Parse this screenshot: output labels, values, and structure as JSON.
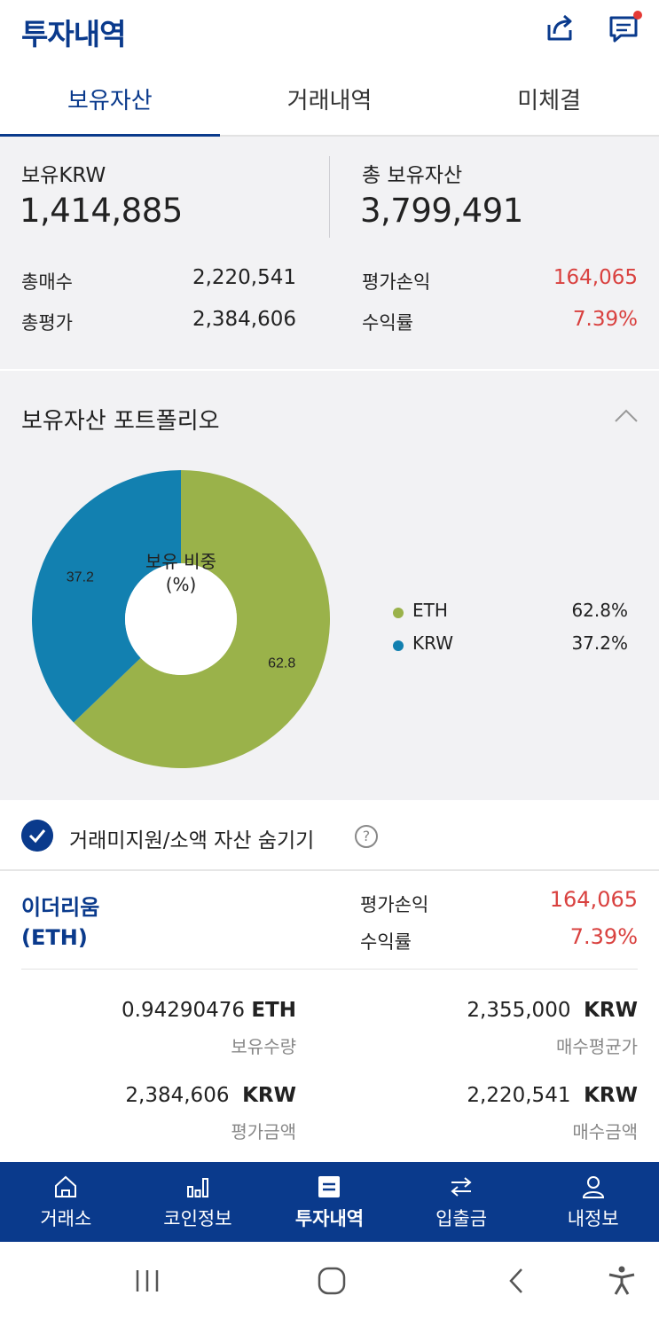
{
  "header": {
    "title": "투자내역"
  },
  "tabs": [
    {
      "label": "보유자산",
      "active": true
    },
    {
      "label": "거래내역",
      "active": false
    },
    {
      "label": "미체결",
      "active": false
    }
  ],
  "summary": {
    "krw_label": "보유KRW",
    "krw_value": "1,414,885",
    "total_label": "총 보유자산",
    "total_value": "3,799,491",
    "buy_label": "총매수",
    "buy_value": "2,220,541",
    "eval_label": "총평가",
    "eval_value": "2,384,606",
    "pl_label": "평가손익",
    "pl_value": "164,065",
    "rate_label": "수익률",
    "rate_value": "7.39%"
  },
  "portfolio": {
    "title": "보유자산 포트폴리오",
    "center_line1": "보유 비중",
    "center_line2": "(%)",
    "legend": [
      {
        "name": "ETH",
        "pct": "62.8%",
        "color": "#9ab24a"
      },
      {
        "name": "KRW",
        "pct": "37.2%",
        "color": "#1280b0"
      }
    ]
  },
  "chart_data": {
    "type": "pie",
    "categories": [
      "ETH",
      "KRW"
    ],
    "values": [
      62.8,
      37.2
    ],
    "colors": [
      "#9ab24a",
      "#1280b0"
    ],
    "data_labels": [
      "62.8",
      "37.2"
    ]
  },
  "hide_small": {
    "label": "거래미지원/소액 자산 숨기기",
    "checked": true,
    "help": "?"
  },
  "coin": {
    "name_line1": "이더리움",
    "name_line2": "(ETH)",
    "pl_label": "평가손익",
    "pl_value": "164,065",
    "rate_label": "수익률",
    "rate_value": "7.39%",
    "qty_value": "0.94290476",
    "qty_unit": "ETH",
    "qty_label": "보유수량",
    "avg_value": "2,355,000",
    "avg_unit": "KRW",
    "avg_label": "매수평균가",
    "eval_value": "2,384,606",
    "eval_unit": "KRW",
    "eval_label": "평가금액",
    "buy_value": "2,220,541",
    "buy_unit": "KRW",
    "buy_label": "매수금액"
  },
  "bottom_nav": [
    {
      "label": "거래소",
      "icon": "home-icon",
      "active": false
    },
    {
      "label": "코인정보",
      "icon": "bar-chart-icon",
      "active": false
    },
    {
      "label": "투자내역",
      "icon": "list-icon",
      "active": true
    },
    {
      "label": "입출금",
      "icon": "transfer-icon",
      "active": false
    },
    {
      "label": "내정보",
      "icon": "user-icon",
      "active": false
    }
  ],
  "colors": {
    "brand": "#0a3a8c",
    "profit": "#d9413f",
    "notification": "#e53935"
  }
}
